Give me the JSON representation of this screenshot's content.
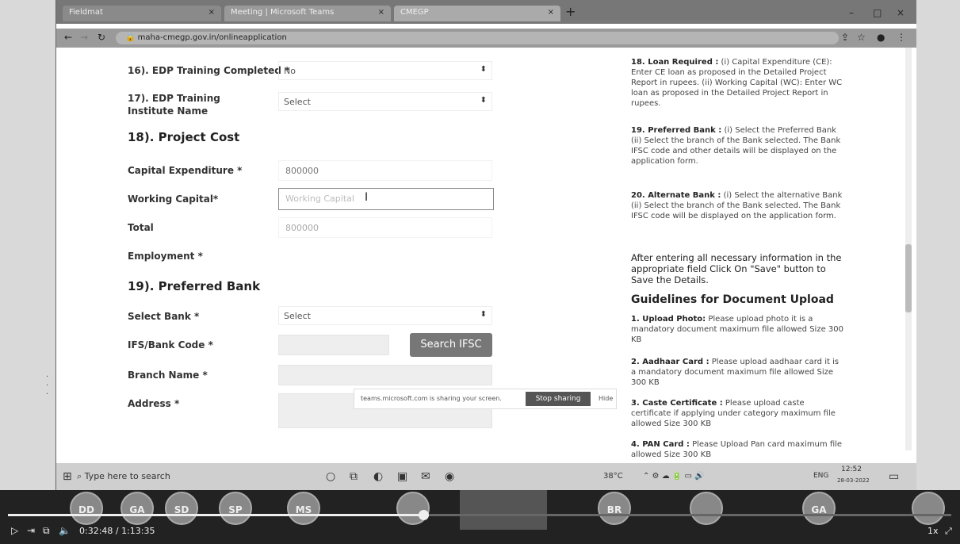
{
  "browser": {
    "tabs": [
      {
        "label": "Fieldmat",
        "close": "×"
      },
      {
        "label": "Meeting | Microsoft Teams",
        "close": "×"
      },
      {
        "label": "CMEGP",
        "close": "×"
      }
    ],
    "new_tab": "+",
    "url": "maha-cmegp.gov.in/onlineapplication",
    "window_controls": [
      "–",
      "□",
      "×"
    ]
  },
  "form": {
    "field16": {
      "label": "16). EDP Training Completed *",
      "value": "No"
    },
    "field17": {
      "label": "17). EDP Training Institute Name",
      "value": "Select"
    },
    "section18": "18). Project Cost",
    "capital_expenditure": {
      "label": "Capital Expenditure *",
      "value": "800000"
    },
    "working_capital": {
      "label": "Working Capital*",
      "placeholder": "Working Capital"
    },
    "total": {
      "label": "Total",
      "value": "800000"
    },
    "employment": {
      "label": "Employment *"
    },
    "section19": "19). Preferred Bank",
    "select_bank": {
      "label": "Select Bank *",
      "value": "Select"
    },
    "ifsc": {
      "label": "IFS/Bank Code *",
      "button": "Search IFSC"
    },
    "branch_name": {
      "label": "Branch Name *"
    },
    "address": {
      "label": "Address *"
    }
  },
  "guidelines": {
    "item18": {
      "head": "18. Loan Required :",
      "text": "(i) Capital Expenditure (CE): Enter CE loan as proposed in the Detailed Project Report in rupees. (ii) Working Capital (WC): Enter WC loan as proposed in the Detailed Project Report in rupees."
    },
    "item19": {
      "head": "19. Preferred Bank :",
      "text": "(i) Select the Preferred Bank (ii) Select the branch of the Bank selected. The Bank IFSC code and other details will be displayed on the application form."
    },
    "item20": {
      "head": "20. Alternate Bank :",
      "text": "(i) Select the alternative Bank (ii) Select the branch of the Bank selected. The Bank IFSC code will be displayed on the application form."
    },
    "save_note": "After entering all necessary information in the appropriate field Click On \"Save\" button to Save the Details.",
    "doc_title": "Guidelines for Document Upload",
    "doc1": {
      "head": "1. Upload Photo:",
      "text": "Please upload photo it is a mandatory document maximum file allowed Size 300 KB"
    },
    "doc2": {
      "head": "2. Aadhaar Card :",
      "text": "Please upload aadhaar card it is a mandatory document maximum file allowed Size 300 KB"
    },
    "doc3": {
      "head": "3. Caste Certificate :",
      "text": "Please upload caste certificate if applying under category maximum file allowed Size 300 KB"
    },
    "doc4": {
      "head": "4. PAN Card :",
      "text": "Please Upload Pan card maximum file allowed Size 300 KB"
    }
  },
  "share_bar": {
    "text": "teams.microsoft.com is sharing your screen.",
    "stop": "Stop sharing",
    "hide": "Hide"
  },
  "taskbar": {
    "search_placeholder": "Type here to search",
    "temperature": "38°C",
    "language": "ENG",
    "time": "12:52",
    "date": "28-03-2022"
  },
  "player": {
    "time": "0:32:48 / 1:13:35",
    "progress": 0.44,
    "speed": "1x",
    "participants": [
      "DD",
      "GA",
      "SD",
      "SP",
      "MS",
      "BR",
      "GA"
    ]
  }
}
